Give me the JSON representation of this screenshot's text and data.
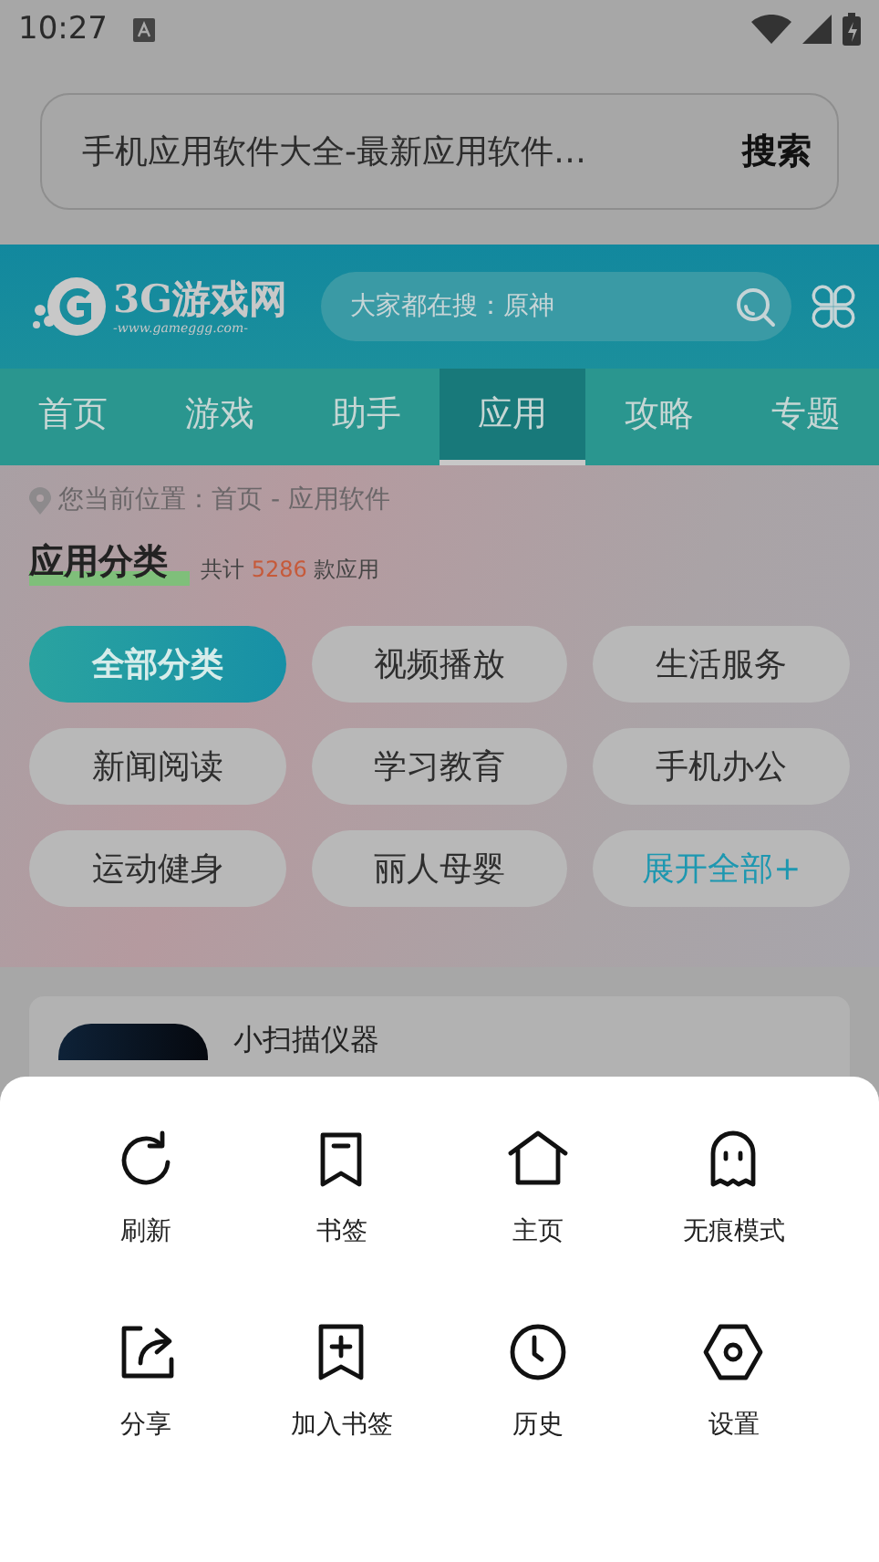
{
  "status_bar": {
    "time": "10:27"
  },
  "browser_bar": {
    "address": "手机应用软件大全-最新应用软件…",
    "button": "搜索"
  },
  "site_header": {
    "logo": "3G游戏网",
    "logo_url": "-www.gameggg.com-",
    "search_placeholder": "大家都在搜：原神"
  },
  "nav_tabs": [
    {
      "label": "首页",
      "selected": false
    },
    {
      "label": "游戏",
      "selected": false
    },
    {
      "label": "助手",
      "selected": false
    },
    {
      "label": "应用",
      "selected": true
    },
    {
      "label": "攻略",
      "selected": false
    },
    {
      "label": "专题",
      "selected": false
    }
  ],
  "breadcrumb": "您当前位置：首页 - 应用软件",
  "section": {
    "title": "应用分类",
    "count_prefix": "共计",
    "count": "5286",
    "count_suffix": "款应用"
  },
  "categories": [
    {
      "label": "全部分类",
      "kind": "category",
      "selected": true
    },
    {
      "label": "视频播放",
      "kind": "category",
      "selected": false
    },
    {
      "label": "生活服务",
      "kind": "category",
      "selected": false
    },
    {
      "label": "新闻阅读",
      "kind": "category",
      "selected": false
    },
    {
      "label": "学习教育",
      "kind": "category",
      "selected": false
    },
    {
      "label": "手机办公",
      "kind": "category",
      "selected": false
    },
    {
      "label": "运动健身",
      "kind": "category",
      "selected": false
    },
    {
      "label": "丽人母婴",
      "kind": "category",
      "selected": false
    },
    {
      "label": "展开全部+",
      "kind": "expand",
      "selected": false
    }
  ],
  "app_card": {
    "title": "小扫描仪器"
  },
  "menu": [
    {
      "label": "刷新"
    },
    {
      "label": "书签"
    },
    {
      "label": "主页"
    },
    {
      "label": "无痕模式"
    },
    {
      "label": "分享"
    },
    {
      "label": "加入书签"
    },
    {
      "label": "历史"
    },
    {
      "label": "设置"
    }
  ]
}
